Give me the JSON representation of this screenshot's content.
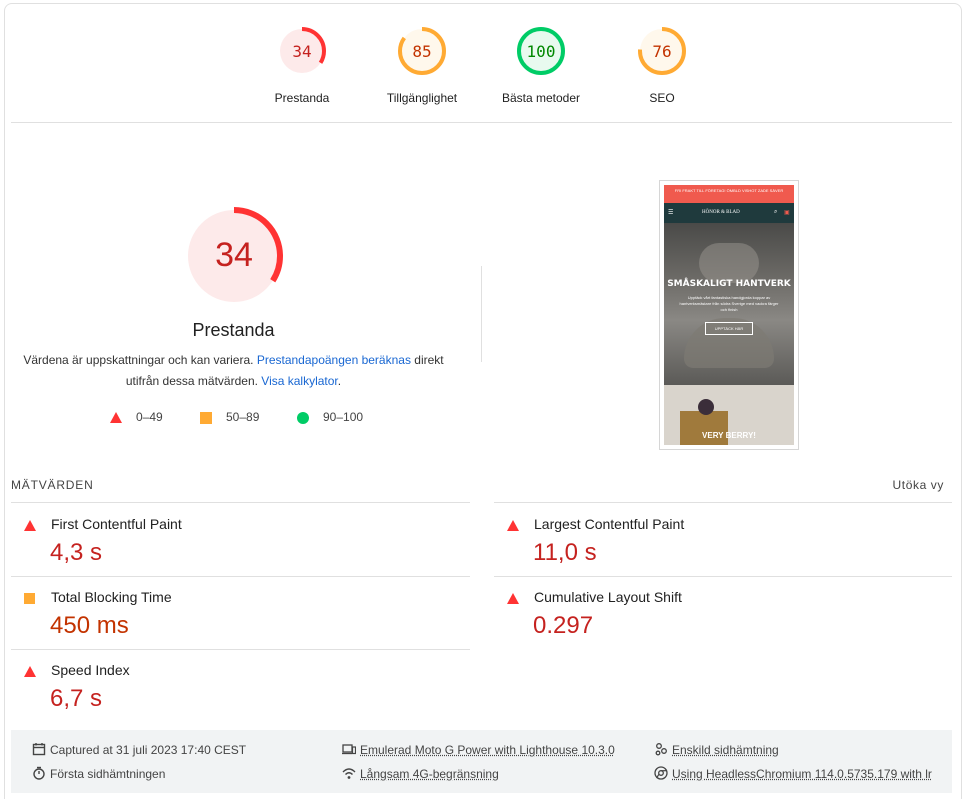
{
  "categories": [
    {
      "score": "34",
      "label": "Prestanda",
      "color": "#ff3333",
      "bg": "#fdeaea",
      "fraction": 0.34
    },
    {
      "score": "85",
      "label": "Tillgänglighet",
      "color": "#ffaa33",
      "bg": "#fff8ec",
      "fraction": 0.85
    },
    {
      "score": "100",
      "label": "Bästa metoder",
      "color": "#00cc66",
      "bg": "#e8faef",
      "fraction": 1.0
    },
    {
      "score": "76",
      "label": "SEO",
      "color": "#ffaa33",
      "bg": "#fff8ec",
      "fraction": 0.76
    }
  ],
  "performance": {
    "score": "34",
    "fraction": 0.34,
    "title": "Prestanda",
    "desc_part1": "Värdena är uppskattningar och kan variera. ",
    "desc_link1": "Prestandapoängen beräknas",
    "desc_part2": " direkt utifrån dessa mätvärden. ",
    "desc_link2": "Visa kalkylator",
    "desc_part3": "."
  },
  "legend": {
    "fail": "0–49",
    "average": "50–89",
    "pass": "90–100"
  },
  "thumbnail": {
    "banner": "FRI FRAKT TILL FÖRETAG! ÖMBLD VISHOT ZADE SÄVER",
    "logo": "HÖNOR & BLAD",
    "hero_title": "SMÅSKALIGT HANTVERK",
    "hero_text": "Upptäck vårt fantastiska handgjorda koppar av hantverksmästare från södra Sverige med vackra färger och finish",
    "cta": "UPPTÄCK HÄR",
    "bottom_title": "VERY BERRY!"
  },
  "metrics": {
    "heading": "MÄTVÄRDEN",
    "expand": "Utöka vy",
    "items": [
      {
        "title": "First Contentful Paint",
        "value": "4,3 s",
        "status": "fail"
      },
      {
        "title": "Largest Contentful Paint",
        "value": "11,0 s",
        "status": "fail"
      },
      {
        "title": "Total Blocking Time",
        "value": "450 ms",
        "status": "average"
      },
      {
        "title": "Cumulative Layout Shift",
        "value": "0.297",
        "status": "fail"
      },
      {
        "title": "Speed Index",
        "value": "6,7 s",
        "status": "fail"
      }
    ]
  },
  "footer": {
    "captured": "Captured at 31 juli 2023 17:40 CEST",
    "first_load": "Första sidhämtningen",
    "device": "Emulerad Moto G Power with Lighthouse 10.3.0",
    "network": "Långsam 4G-begränsning",
    "single_load": "Enskild sidhämtning",
    "browser": "Using HeadlessChromium 114.0.5735.179 with lr"
  },
  "colors": {
    "fail": "#ff3333",
    "average": "#ffaa33",
    "pass": "#00cc66",
    "link": "#1967d2"
  }
}
